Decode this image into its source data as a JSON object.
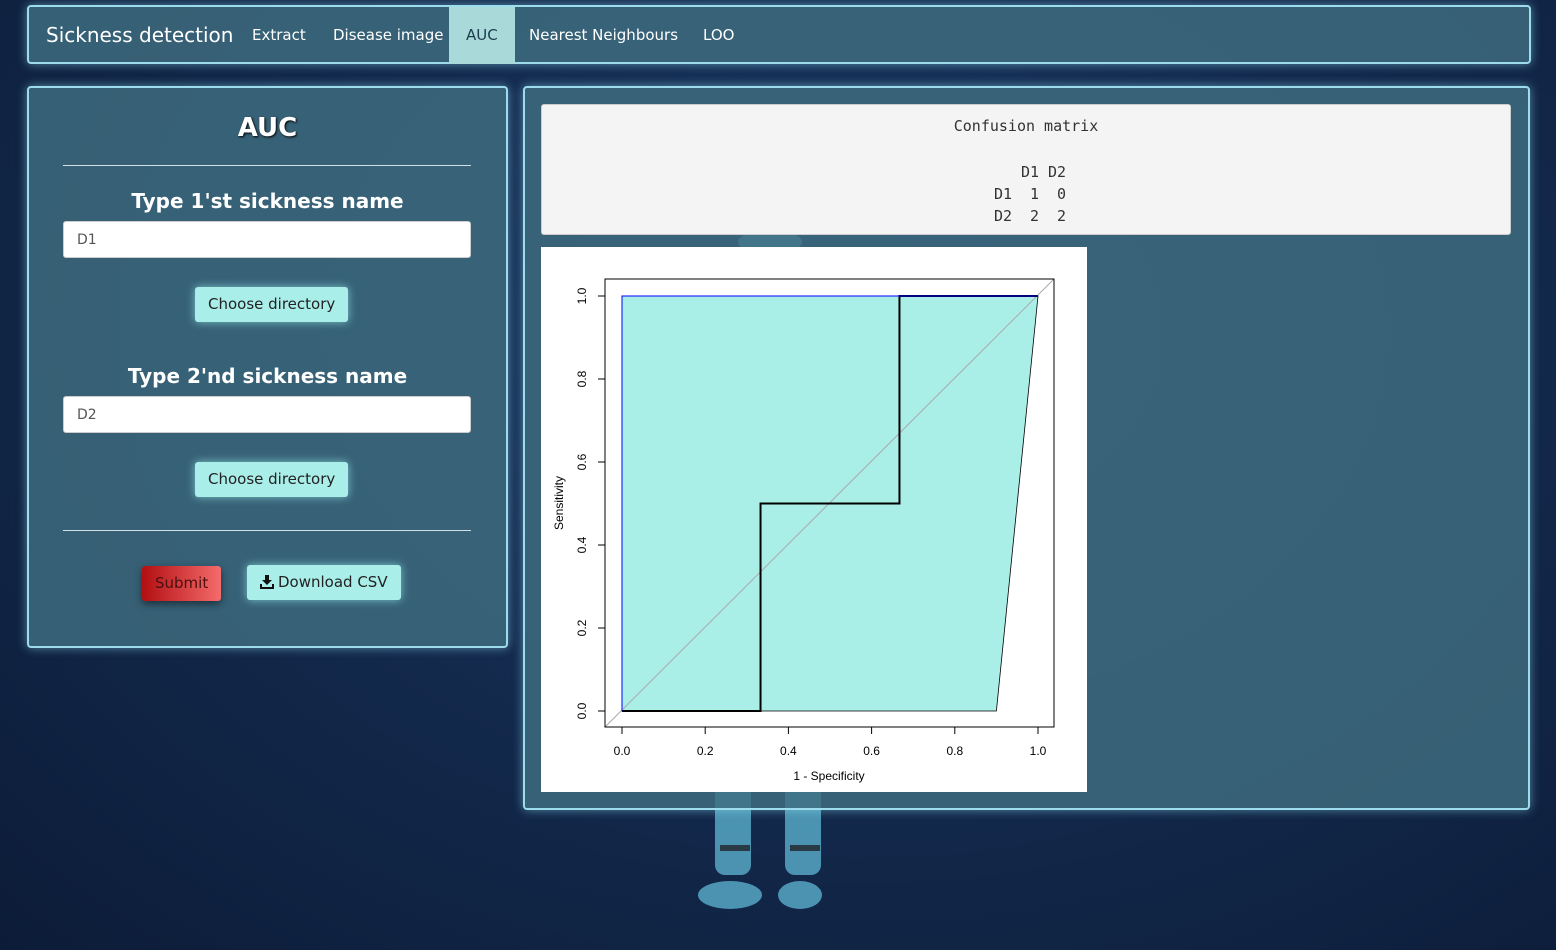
{
  "navbar": {
    "brand": "Sickness detection",
    "items": [
      {
        "label": "Extract",
        "active": false
      },
      {
        "label": "Disease image",
        "active": false
      },
      {
        "label": "AUC",
        "active": true
      },
      {
        "label": "Nearest Neighbours",
        "active": false
      },
      {
        "label": "LOO",
        "active": false
      }
    ]
  },
  "left_panel": {
    "title": "AUC",
    "field1": {
      "label": "Type 1'st sickness name",
      "value": "D1",
      "button": "Choose directory"
    },
    "field2": {
      "label": "Type 2'nd sickness name",
      "value": "D2",
      "button": "Choose directory"
    },
    "submit_label": "Submit",
    "download_label": "Download CSV",
    "download_icon": "download-icon"
  },
  "right_panel": {
    "confusion": {
      "title": "Confusion matrix",
      "columns": [
        "D1",
        "D2"
      ],
      "rows": [
        {
          "label": "D1",
          "values": [
            1,
            0
          ]
        },
        {
          "label": "D2",
          "values": [
            2,
            2
          ]
        }
      ]
    }
  },
  "chart_data": {
    "type": "line",
    "title": "",
    "xlabel": "1 - Specificity",
    "ylabel": "Sensitivity",
    "xlim": [
      0,
      1
    ],
    "ylim": [
      0,
      1
    ],
    "x_ticks": [
      "0.0",
      "0.2",
      "0.4",
      "0.6",
      "0.8",
      "1.0"
    ],
    "y_ticks": [
      "0.0",
      "0.2",
      "0.4",
      "0.6",
      "0.8",
      "1.0"
    ],
    "grid": false,
    "series": [
      {
        "style": "step",
        "color": "#000000",
        "x": [
          0,
          0.333,
          0.333,
          0.667,
          0.667,
          1.0
        ],
        "y": [
          0,
          0,
          0.5,
          0.5,
          1.0,
          1.0
        ]
      },
      {
        "style": "band-upper",
        "color": "#0000ff",
        "x": [
          0,
          0,
          1.0
        ],
        "y": [
          0,
          1.0,
          1.0
        ]
      }
    ],
    "confidence_band": {
      "fill": "#aaeee8",
      "polygon_x": [
        0,
        0,
        1.0,
        0.9
      ],
      "polygon_y": [
        0,
        1.0,
        1.0,
        0
      ]
    },
    "diagonal": {
      "color": "#aaaaaa"
    }
  }
}
